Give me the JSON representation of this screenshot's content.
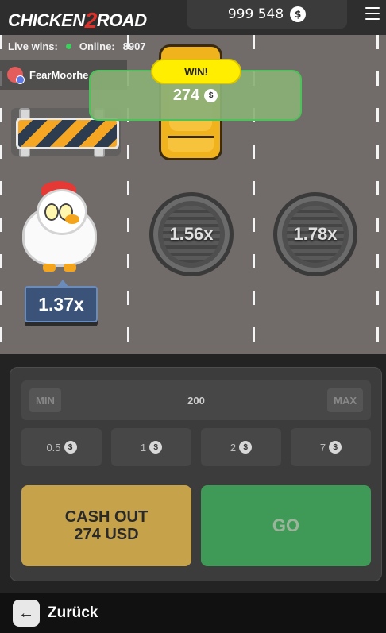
{
  "header": {
    "logo_text_1": "CHICKEN",
    "logo_text_2": "2",
    "logo_text_3": "ROAD",
    "balance": "999 548",
    "currency_icon": "dollar-coin-icon"
  },
  "stats": {
    "live_wins_label": "Live wins:",
    "online_label": "Online:",
    "online_count": "8907"
  },
  "feed": {
    "player_name": "FearMoorhe"
  },
  "win_popup": {
    "badge": "WIN!",
    "amount": "274"
  },
  "multipliers": {
    "current": "1.37x",
    "next": [
      "1.56x",
      "1.78x"
    ]
  },
  "bet": {
    "min_label": "MIN",
    "max_label": "MAX",
    "amount": "200",
    "quick_amounts": [
      "0.5",
      "1",
      "2",
      "7"
    ]
  },
  "actions": {
    "cashout_line1": "CASH OUT",
    "cashout_line2": "274 USD",
    "go_label": "GO"
  },
  "footer": {
    "back_label": "Zurück"
  },
  "colors": {
    "road": "#716b6a",
    "win_badge": "#ffee00",
    "cashout": "#c6a24a",
    "go": "#3f9a58",
    "multiplier_active": "#3b5379"
  }
}
